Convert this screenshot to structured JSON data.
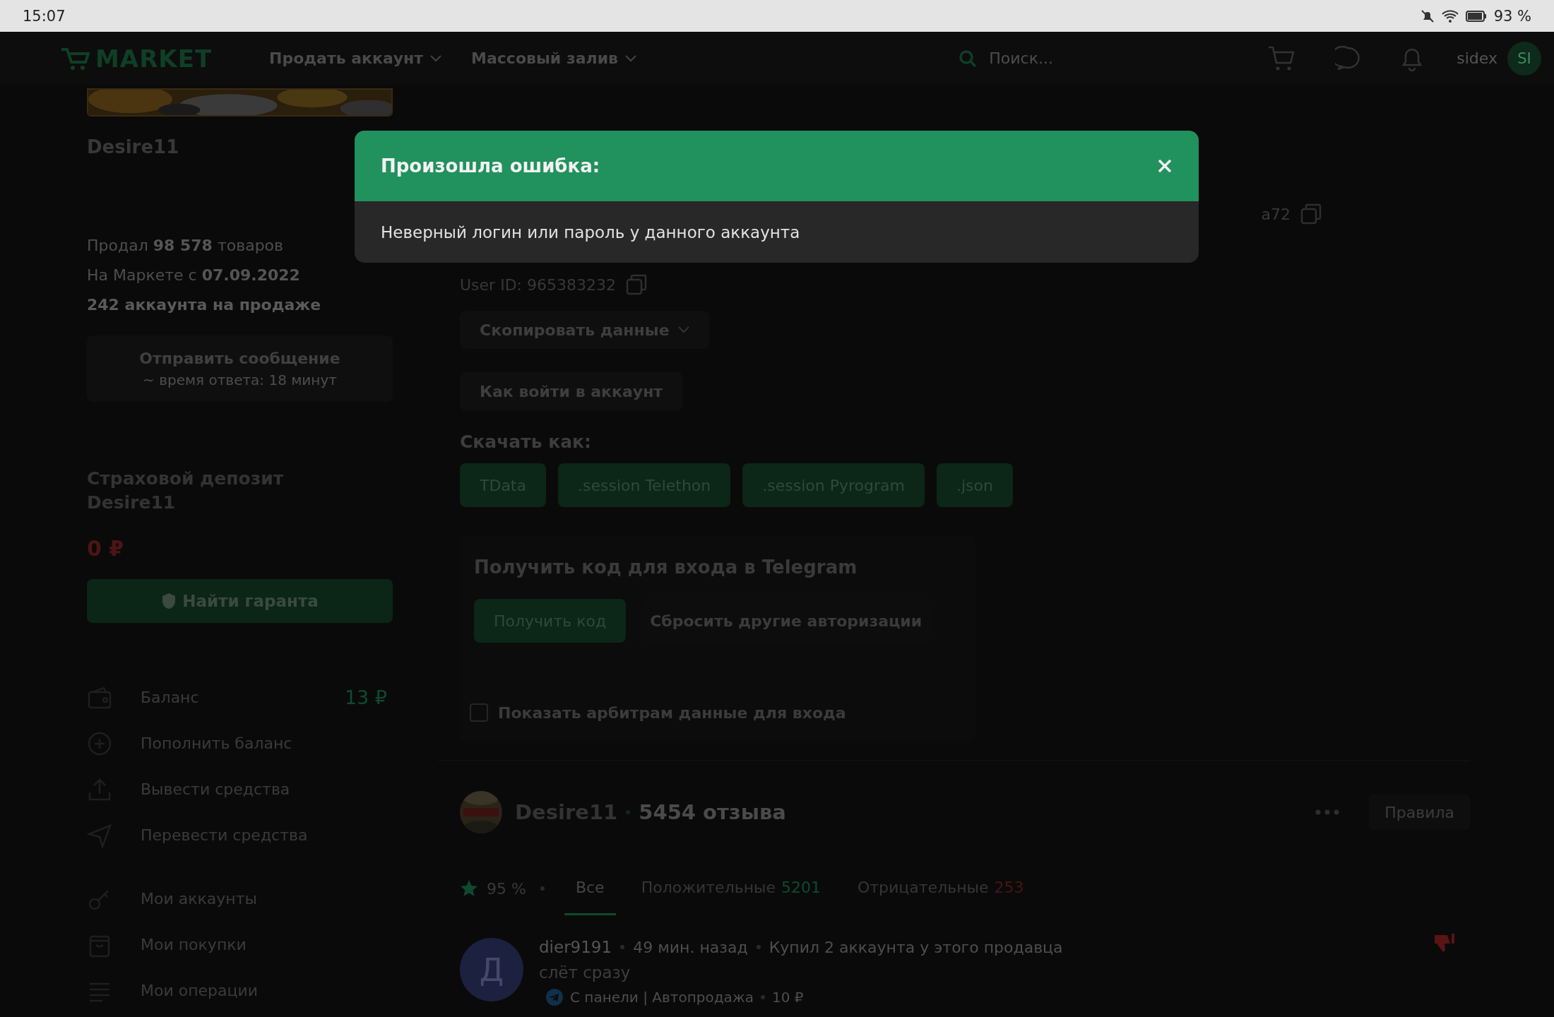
{
  "status_bar": {
    "time": "15:07",
    "battery": "93 %"
  },
  "navbar": {
    "logo": "MARKET",
    "menus": [
      {
        "label": "Продать аккаунт"
      },
      {
        "label": "Массовый залив"
      }
    ],
    "search": {
      "placeholder": "Поиск..."
    },
    "username": "sidex",
    "avatar": "SI"
  },
  "seller": {
    "name": "Desire11",
    "stats": [
      {
        "kind": "plain",
        "text": "Продал **98 578** товаров"
      },
      {
        "kind": "plain",
        "text": "На Маркете с **07.09.2022**"
      },
      {
        "kind": "emphasis",
        "text": "242 аккаунта на продаже"
      }
    ],
    "message_button": {
      "label": "Отправить сообщение",
      "note": "~ время ответа: 18 минут"
    },
    "deposit": {
      "title": "Страховой депозит Desire11",
      "amount": "0 ₽",
      "button": "Найти гаранта"
    },
    "wallet_menu": [
      {
        "kind": "balance",
        "label": "Баланс",
        "value": "13 ₽"
      },
      {
        "kind": "top_up",
        "label": "Пополнить баланс"
      },
      {
        "kind": "withdraw",
        "label": "Вывести средства"
      },
      {
        "kind": "transfer",
        "label": "Перевести средства"
      }
    ],
    "account_menu": [
      {
        "kind": "accounts",
        "label": "Мои аккаунты"
      },
      {
        "kind": "purchases",
        "label": "Мои покупки"
      },
      {
        "kind": "operations",
        "label": "Мои операции"
      }
    ]
  },
  "account": {
    "login_tail": "a72",
    "user_id": "User ID: 965383232",
    "copy_data": "Скопировать данные",
    "how_to_login": "Как войти в аккаунт",
    "download_label": "Скачать как:",
    "downloads": [
      "TData",
      ".session Telethon",
      ".session Pyrogram",
      ".json"
    ]
  },
  "telegram_code": {
    "title": "Получить код для входа в Telegram",
    "get_code": "Получить код",
    "reset": "Сбросить другие авторизации",
    "show_arbiters": {
      "label": "Показать арбитрам данные для входа",
      "checked": false
    }
  },
  "reviews": {
    "seller": "Desire11",
    "count": "5454 отзыва",
    "rules": "Правила",
    "rating": "95 %",
    "tabs": [
      {
        "label": "Все",
        "selected": true
      },
      {
        "kind": "positive",
        "label": "Положительные",
        "count": "5201",
        "selected": false
      },
      {
        "kind": "negative",
        "label": "Отрицательные",
        "count": "253",
        "selected": false
      }
    ],
    "items": [
      {
        "kind": "negative",
        "avatar": "Д",
        "author": "dier9191",
        "time": "49 мин. назад",
        "note": "Купил 2 аккаунта у этого продавца",
        "text": "слёт сразу",
        "source": "С панели | Автопродажа",
        "price": "10 ₽"
      }
    ]
  },
  "modal": {
    "title": "Произошла ошибка:",
    "message": "Неверный логин или пароль у данного аккаунта"
  }
}
